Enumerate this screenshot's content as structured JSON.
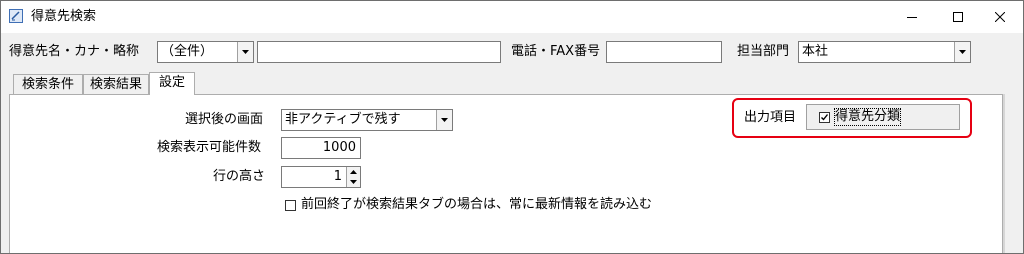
{
  "window": {
    "title": "得意先検索"
  },
  "search": {
    "name_label": "得意先名・カナ・略称",
    "name_mode": "（全件）",
    "name_value": "",
    "phone_label": "電話・FAX番号",
    "phone_value": "",
    "dept_label": "担当部門",
    "dept_value": "本社"
  },
  "tabs": [
    {
      "label": "検索条件",
      "active": false
    },
    {
      "label": "検索結果",
      "active": false
    },
    {
      "label": "設定",
      "active": true
    }
  ],
  "settings": {
    "after_select_label": "選択後の画面",
    "after_select_value": "非アクティブで残す",
    "max_results_label": "検索表示可能件数",
    "max_results_value": "1000",
    "row_height_label": "行の高さ",
    "row_height_value": "1",
    "restore_tab_label": "前回終了が検索結果タブの場合は、常に最新情報を読み込む",
    "restore_tab_checked": false
  },
  "output_items": {
    "label": "出力項目",
    "option_label": "得意先分類",
    "option_checked": true,
    "highlight_color": "#e60012"
  }
}
